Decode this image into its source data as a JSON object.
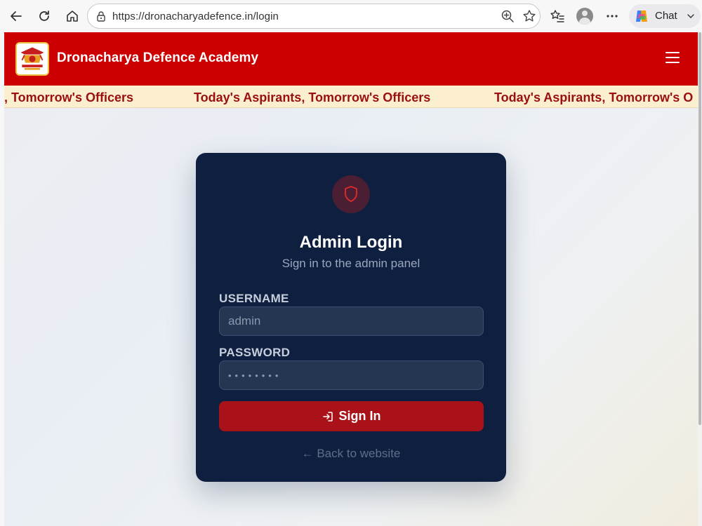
{
  "browser": {
    "url": "https://dronacharyadefence.in/login",
    "chat_label": "Chat"
  },
  "site": {
    "title": "Dronacharya Defence Academy",
    "ticker": [
      ", Tomorrow's Officers",
      "Today's Aspirants, Tomorrow's Officers",
      "Today's Aspirants, Tomorrow's O"
    ]
  },
  "login": {
    "title": "Admin Login",
    "subtitle": "Sign in to the admin panel",
    "username_label": "USERNAME",
    "username_placeholder": "admin",
    "password_label": "PASSWORD",
    "password_placeholder": "••••••••",
    "signin_label": "Sign In",
    "back_link": "← Back to website"
  },
  "colors": {
    "header_red": "#cc0000",
    "card_navy": "#0f1f3f",
    "button_red": "#a81218",
    "ticker_bg": "#fbefcf"
  }
}
